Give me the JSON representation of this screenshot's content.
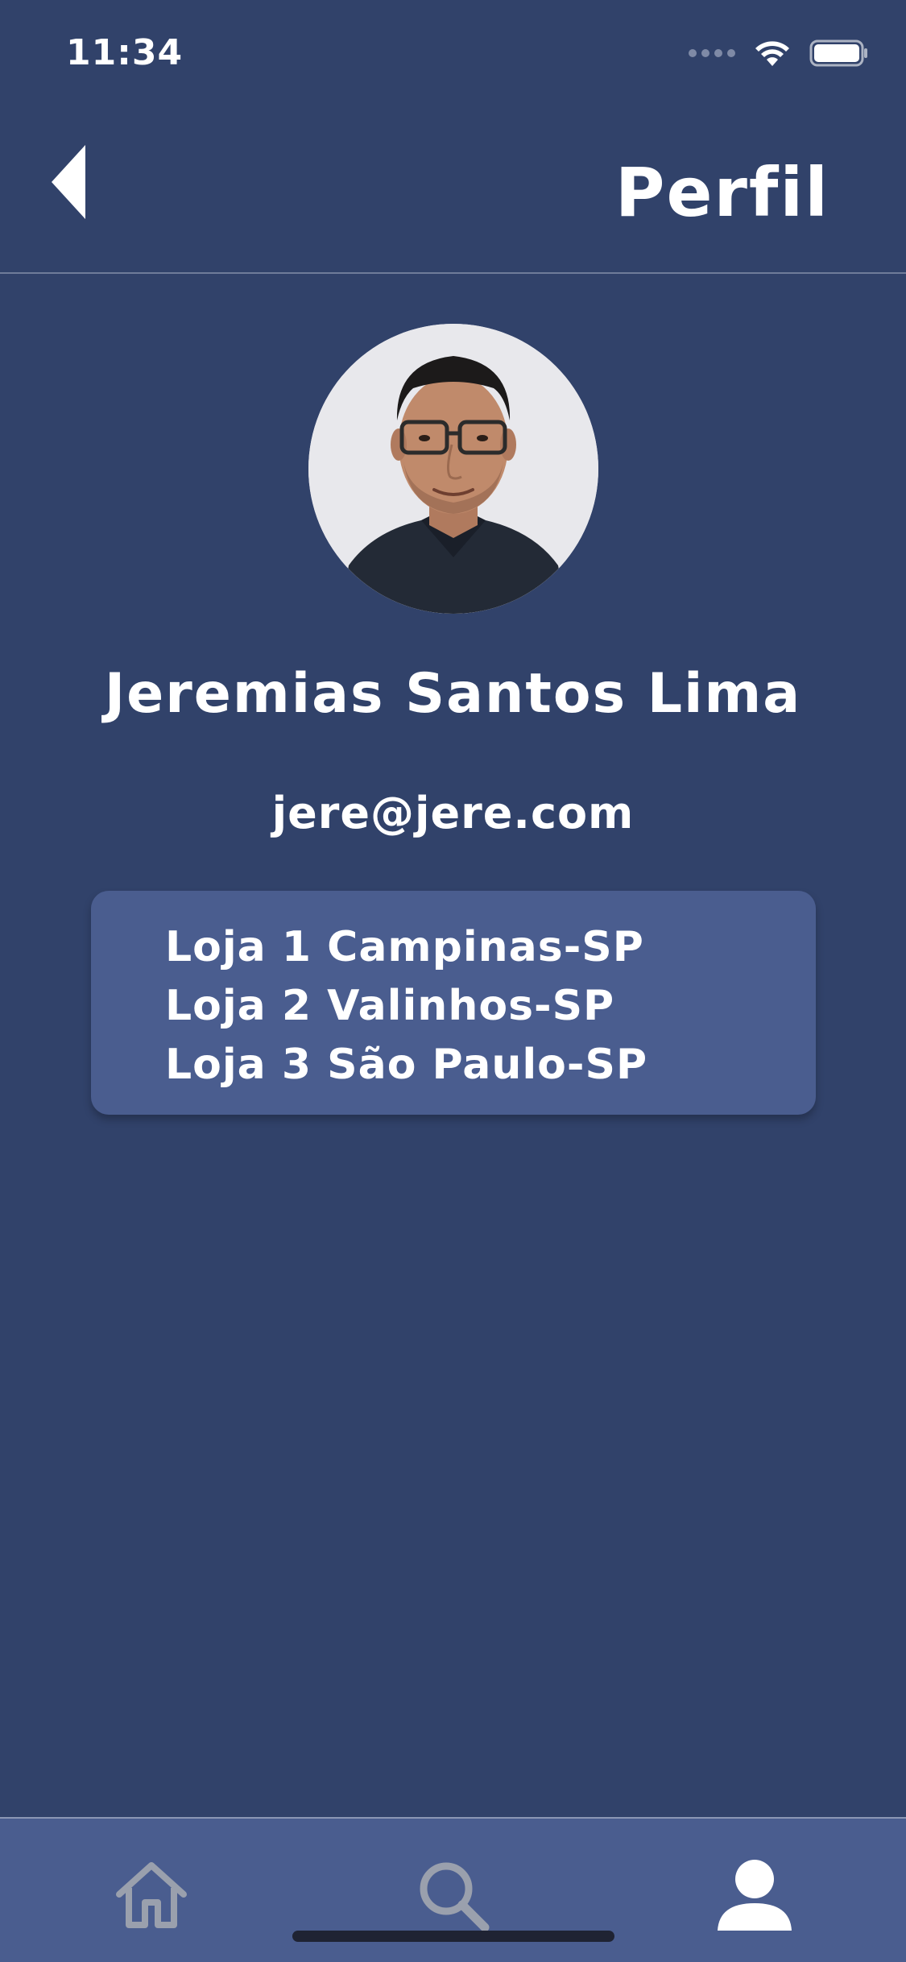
{
  "status_bar": {
    "time": "11:34",
    "signal_icon": "signal-dots-icon",
    "wifi_icon": "wifi-icon",
    "battery_icon": "battery-icon"
  },
  "header": {
    "title": "Perfil",
    "back_icon": "back-triangle-icon"
  },
  "profile": {
    "name": "Jeremias Santos Lima",
    "email": "jere@jere.com"
  },
  "stores": [
    {
      "label": "Loja 1 Campinas-SP"
    },
    {
      "label": "Loja 2 Valinhos-SP"
    },
    {
      "label": "Loja 3 São Paulo-SP"
    }
  ],
  "tab_bar": {
    "tabs": [
      {
        "name": "home",
        "icon": "home-icon",
        "active": false
      },
      {
        "name": "search",
        "icon": "search-icon",
        "active": false
      },
      {
        "name": "profile",
        "icon": "person-icon",
        "active": true
      }
    ]
  },
  "colors": {
    "background": "#31426a",
    "card": "#4a5d8f",
    "tab_bar": "#4a5d8f",
    "text": "#ffffff",
    "inactive_icon": "#9aa0ad"
  }
}
